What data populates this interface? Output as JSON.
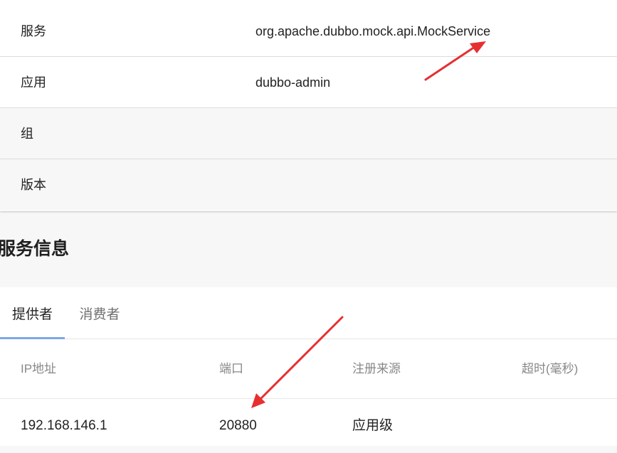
{
  "details": [
    {
      "key": "服务",
      "value": "org.apache.dubbo.mock.api.MockService"
    },
    {
      "key": "应用",
      "value": "dubbo-admin"
    },
    {
      "key": "组",
      "value": ""
    },
    {
      "key": "版本",
      "value": ""
    }
  ],
  "section_title": "服务信息",
  "tabs": [
    "提供者",
    "消费者"
  ],
  "table": {
    "headers": [
      "IP地址",
      "端口",
      "注册来源",
      "超时(毫秒)"
    ],
    "rows": [
      [
        "192.168.146.1",
        "20880",
        "应用级",
        ""
      ]
    ]
  },
  "colors": {
    "tab_indicator": "#7ea6e6",
    "annotation_arrow": "#e5302f"
  }
}
